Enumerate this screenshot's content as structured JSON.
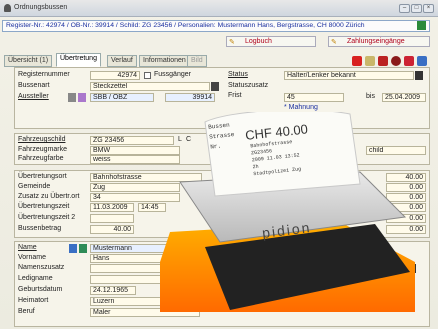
{
  "window": {
    "title": "Ordnungsbussen"
  },
  "register_bar": "Register-Nr.: 42974 / OB-Nr.: 39914 / Schild: ZG 23456 / Personalien: Mustermann Hans, Bergstrasse, CH 8000 Zürich",
  "buttons": {
    "logbuch": "Logbuch",
    "zahlungseingaenge": "Zahlungseingänge"
  },
  "tabs": [
    {
      "label": "Übersicht (1)"
    },
    {
      "label": "Übertretung"
    },
    {
      "label": "Verlauf"
    },
    {
      "label": "Informationen"
    },
    {
      "label": "Bild"
    }
  ],
  "section1": {
    "registernummer_label": "Registernummer",
    "registernummer": "42974",
    "fussgaenger_label": "Fussgänger",
    "bussenart_label": "Bussenart",
    "bussenart": "Steckzettel",
    "aussteller_label": "Aussteller",
    "aussteller": "SBB / OBZ",
    "aussteller_nr": "39914",
    "status_label": "Status",
    "status": "Halter/Lenker bekannt",
    "statuszusatz_label": "Statuszusatz",
    "frist_label": "Frist",
    "frist_days": "45",
    "bis_label": "bis",
    "bis_date": "25.04.2009",
    "mahnung": "* Mahnung"
  },
  "section2": {
    "fahrzeugschild_label": "Fahrzeugschild",
    "fahrzeugschild": "ZG 23456",
    "schild_kind": "L",
    "schild_class": "C",
    "fahrzeugmarke_label": "Fahrzeugmarke",
    "fahrzeugmarke": "BMW",
    "fahrzeugfarbe_label": "Fahrzeugfarbe",
    "fahrzeugfarbe": "weiss",
    "child_value": "child"
  },
  "section3": {
    "uebertretungsort_label": "Übertretungsort",
    "uebertretungsort": "Bahnhofstrasse",
    "gemeinde_label": "Gemeinde",
    "gemeinde": "Zug",
    "zusatz_label": "Zusatz zu Übertr.ort",
    "zusatz": "34",
    "zeit1_label": "Übertretungszeit",
    "zeit1_date": "11.03.2009",
    "zeit1_time": "14:45",
    "zeit2_label": "Übertretungszeit 2",
    "bussenbetrag_label": "Bussenbetrag",
    "bussenbetrag": "40.00",
    "amounts": [
      "40.00",
      "0.00",
      "0.00",
      "0.00",
      "0.00",
      "0.00"
    ]
  },
  "section4": {
    "name_label": "Name",
    "name": "Mustermann",
    "vorname_label": "Vorname",
    "vorname": "Hans",
    "namenszusatz_label": "Namenszusatz",
    "ledigname_label": "Ledigname",
    "geburtsdatum_label": "Geburtsdatum",
    "geburtsdatum": "24.12.1965",
    "heimatort_label": "Heimatort",
    "heimatort": "Luzern",
    "beruf_label": "Beruf",
    "beruf": "Maler",
    "land_kind": "L",
    "land": "CH"
  },
  "receipt": {
    "amount": "CHF 40.00",
    "line_bussen": "Bussen",
    "line_strasse": "Strasse",
    "line_nr": "Nr.",
    "l1": "Bahnhofstrasse",
    "l2": "ZG23456",
    "l3": "2009 11.03 13:52",
    "l4": "2h",
    "l5": "Stadtpolizei Zug"
  },
  "printer": {
    "brand": "pidion"
  },
  "colors": {
    "accent_red": "#b0001b",
    "link_blue": "#1a2fa0",
    "field_yellow": "#fffbea"
  }
}
